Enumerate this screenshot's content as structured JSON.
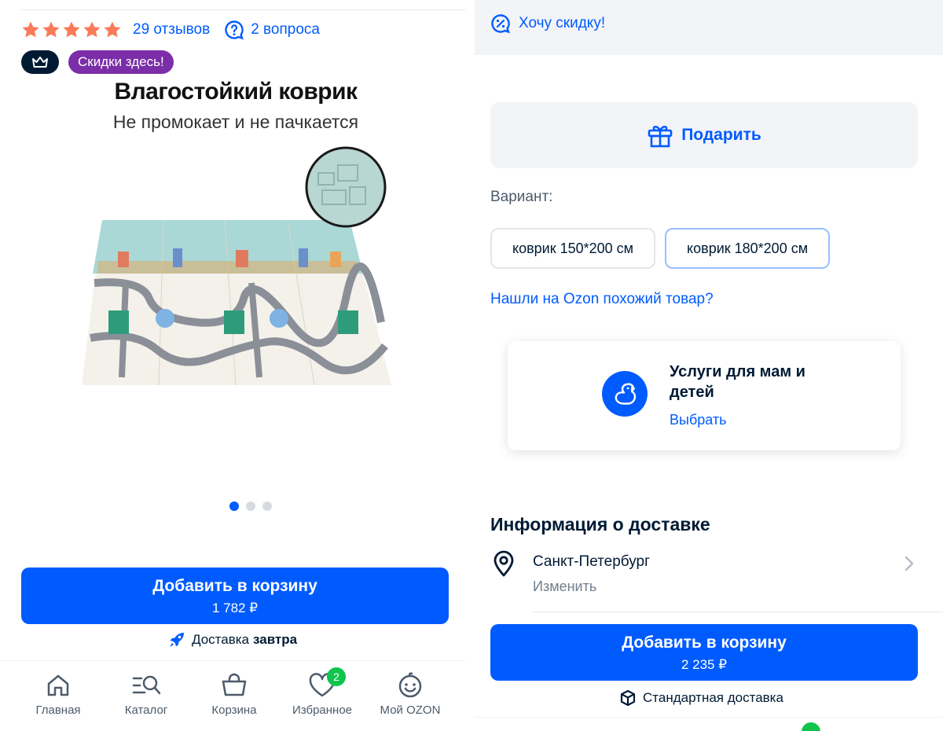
{
  "left": {
    "rating": {
      "stars": 5,
      "reviews": "29 отзывов",
      "questions": "2 вопроса"
    },
    "badge_promo": "Скидки здесь!",
    "product_image": {
      "title": "Влагостойкий коврик",
      "subtitle": "Не промокает и не пачкается"
    },
    "carousel": {
      "count": 3,
      "active": 0
    },
    "cart": {
      "label": "Добавить в корзину",
      "price": "1 782 ₽"
    },
    "delivery": {
      "label": "Доставка",
      "when": "завтра"
    },
    "nav": [
      {
        "label": "Главная",
        "icon": "home-icon"
      },
      {
        "label": "Каталог",
        "icon": "catalog-search-icon"
      },
      {
        "label": "Корзина",
        "icon": "basket-icon"
      },
      {
        "label": "Избранное",
        "icon": "heart-icon",
        "badge": "2"
      },
      {
        "label": "Мой OZON",
        "icon": "smiley-icon"
      }
    ]
  },
  "right": {
    "discount": "Хочу скидку!",
    "gift": "Подарить",
    "variant_label": "Вариант:",
    "variants": [
      {
        "label": "коврик 150*200 см",
        "selected": false
      },
      {
        "label": "коврик 180*200 см",
        "selected": true
      }
    ],
    "similar_link": "Нашли на Ozon похожий товар?",
    "service": {
      "title": "Услуги для мам и детей",
      "link": "Выбрать"
    },
    "delivery_info": {
      "title": "Информация о доставке",
      "city": "Санкт-Петербург",
      "change": "Изменить"
    },
    "cart": {
      "label": "Добавить в корзину",
      "price": "2 235 ₽"
    },
    "delivery_note": "Стандартная доставка"
  },
  "colors": {
    "accent": "#005bff",
    "star": "#f97a5a",
    "promo": "#7b2ea8",
    "badge_green": "#10c44c",
    "dark": "#001a34"
  }
}
